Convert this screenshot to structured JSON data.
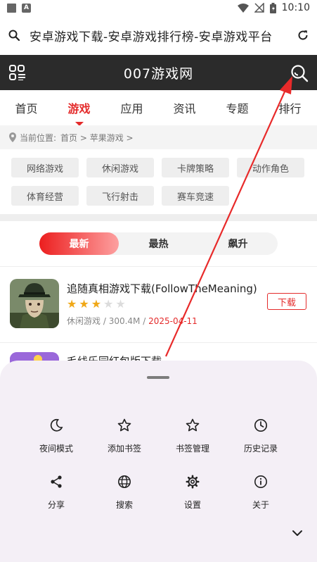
{
  "status_bar": {
    "time": "10:10",
    "app_badge": "A"
  },
  "browser": {
    "url_title": "安卓游戏下载-安卓游戏排行榜-安卓游戏平台"
  },
  "site": {
    "title": "007游戏网"
  },
  "nav": {
    "tabs": [
      {
        "label": "首页"
      },
      {
        "label": "游戏",
        "active": true
      },
      {
        "label": "应用"
      },
      {
        "label": "资讯"
      },
      {
        "label": "专题"
      },
      {
        "label": "排行"
      }
    ]
  },
  "breadcrumb": {
    "label": "当前位置:",
    "path": "首页 > 苹果游戏 >"
  },
  "filters": [
    "网络游戏",
    "休闲游戏",
    "卡牌策略",
    "动作角色",
    "体育经营",
    "飞行射击",
    "赛车竞速"
  ],
  "sort_tabs": [
    {
      "label": "最新",
      "active": true
    },
    {
      "label": "最热"
    },
    {
      "label": "飙升"
    }
  ],
  "apps": [
    {
      "name": "追随真相游戏下载(FollowTheMeaning)",
      "rating": 3,
      "max_rating": 5,
      "category": "休闲游戏",
      "size": "300.4M",
      "date": "2025-04-11",
      "download_label": "下载"
    },
    {
      "name": "毛线乐园红包版下载"
    }
  ],
  "sheet": {
    "items": [
      {
        "label": "夜间模式",
        "icon": "moon-icon"
      },
      {
        "label": "添加书签",
        "icon": "star-icon"
      },
      {
        "label": "书签管理",
        "icon": "star-icon"
      },
      {
        "label": "历史记录",
        "icon": "clock-icon"
      },
      {
        "label": "分享",
        "icon": "share-icon"
      },
      {
        "label": "搜索",
        "icon": "globe-icon"
      },
      {
        "label": "设置",
        "icon": "gear-icon"
      },
      {
        "label": "关于",
        "icon": "info-icon"
      }
    ]
  },
  "colors": {
    "accent": "#e42b2b",
    "header_bg": "#2b2b2b",
    "star": "#f0a817",
    "sheet_bg": "#f4eff6"
  }
}
